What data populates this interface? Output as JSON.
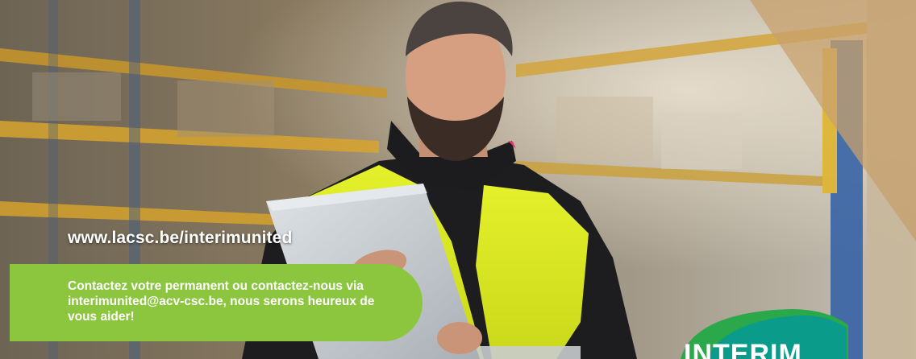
{
  "banner": {
    "photo_description_icon": "warehouse-worker-photo",
    "url": "www.lacsc.be/interimunited",
    "cta_text": "Contactez votre permanent ou contactez-nous via interimunited@acv-csc.be, nous serons heureux de vous aider!",
    "logo_text": "INTERIM",
    "colors": {
      "accent_green": "#8cc63f",
      "logo_teal": "#0a9b8a",
      "logo_green": "#2aa84a"
    }
  }
}
